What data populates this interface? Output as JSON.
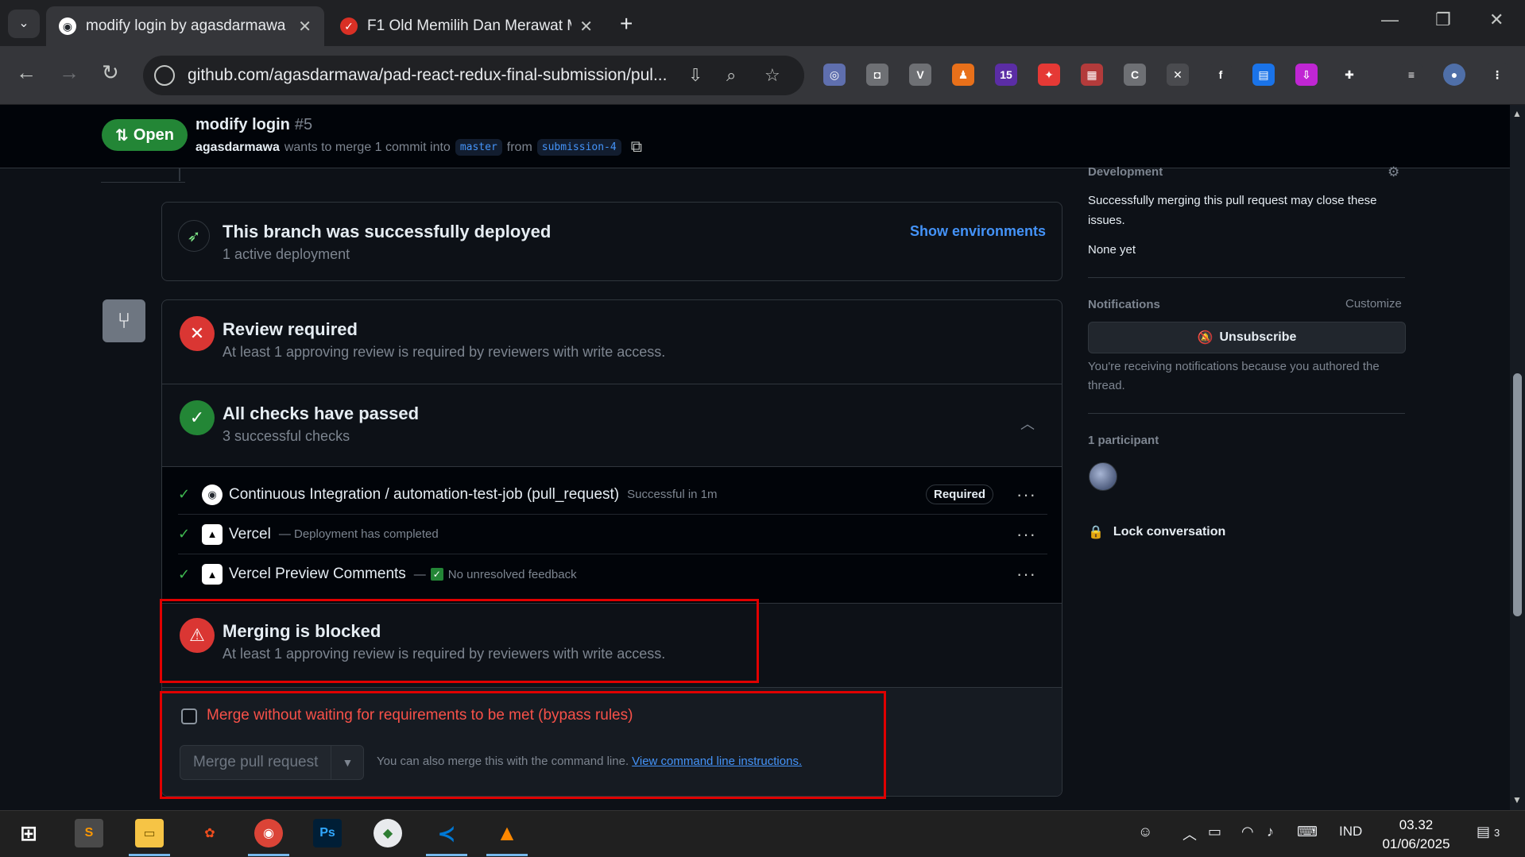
{
  "browser": {
    "tabs": [
      {
        "title": "modify login by agasdarmawa · ",
        "active": true
      },
      {
        "title": "F1 Old Memilih Dan Merawat M",
        "active": false
      }
    ],
    "url": "github.com/agasdarmawa/pad-react-redux-final-submission/pul...",
    "extension_badge": "15"
  },
  "pr": {
    "state": "Open",
    "title": "modify login",
    "number": "#5",
    "author": "agasdarmawa",
    "merge_text": "wants to merge 1 commit into",
    "base_branch": "master",
    "from_text": "from",
    "head_branch": "submission-4"
  },
  "deployment": {
    "title": "This branch was successfully deployed",
    "subtitle": "1 active deployment",
    "link": "Show environments"
  },
  "merge_box": {
    "review": {
      "title": "Review required",
      "subtitle": "At least 1 approving review is required by reviewers with write access."
    },
    "checks": {
      "title": "All checks have passed",
      "subtitle": "3 successful checks",
      "items": [
        {
          "name": "Continuous Integration / automation-test-job (pull_request)",
          "desc": "Successful in 1m",
          "required": "Required"
        },
        {
          "name": "Vercel",
          "desc": "— Deployment has completed"
        },
        {
          "name": "Vercel Preview Comments",
          "desc_prefix": "—",
          "desc": "No unresolved feedback"
        }
      ]
    },
    "blocked": {
      "title": "Merging is blocked",
      "subtitle": "At least 1 approving review is required by reviewers with write access."
    },
    "bypass_label": "Merge without waiting for requirements to be met (bypass rules)",
    "merge_button": "Merge pull request",
    "cli_text": "You can also merge this with the command line.",
    "cli_link": "View command line instructions."
  },
  "sidebar": {
    "development": {
      "label": "Development",
      "text": "Successfully merging this pull request may close these issues.",
      "none": "None yet"
    },
    "notifications": {
      "label": "Notifications",
      "customize": "Customize",
      "button": "Unsubscribe",
      "note": "You're receiving notifications because you authored the thread."
    },
    "participants": {
      "label": "1 participant"
    },
    "lock": "Lock conversation"
  },
  "taskbar": {
    "language": "IND",
    "time": "03.32",
    "date": "01/06/2025",
    "notification_count": "3"
  },
  "colors": {
    "open_green": "#238636",
    "danger_red": "#da3633",
    "link_blue": "#4493f8",
    "highlight_red": "#e00000"
  }
}
